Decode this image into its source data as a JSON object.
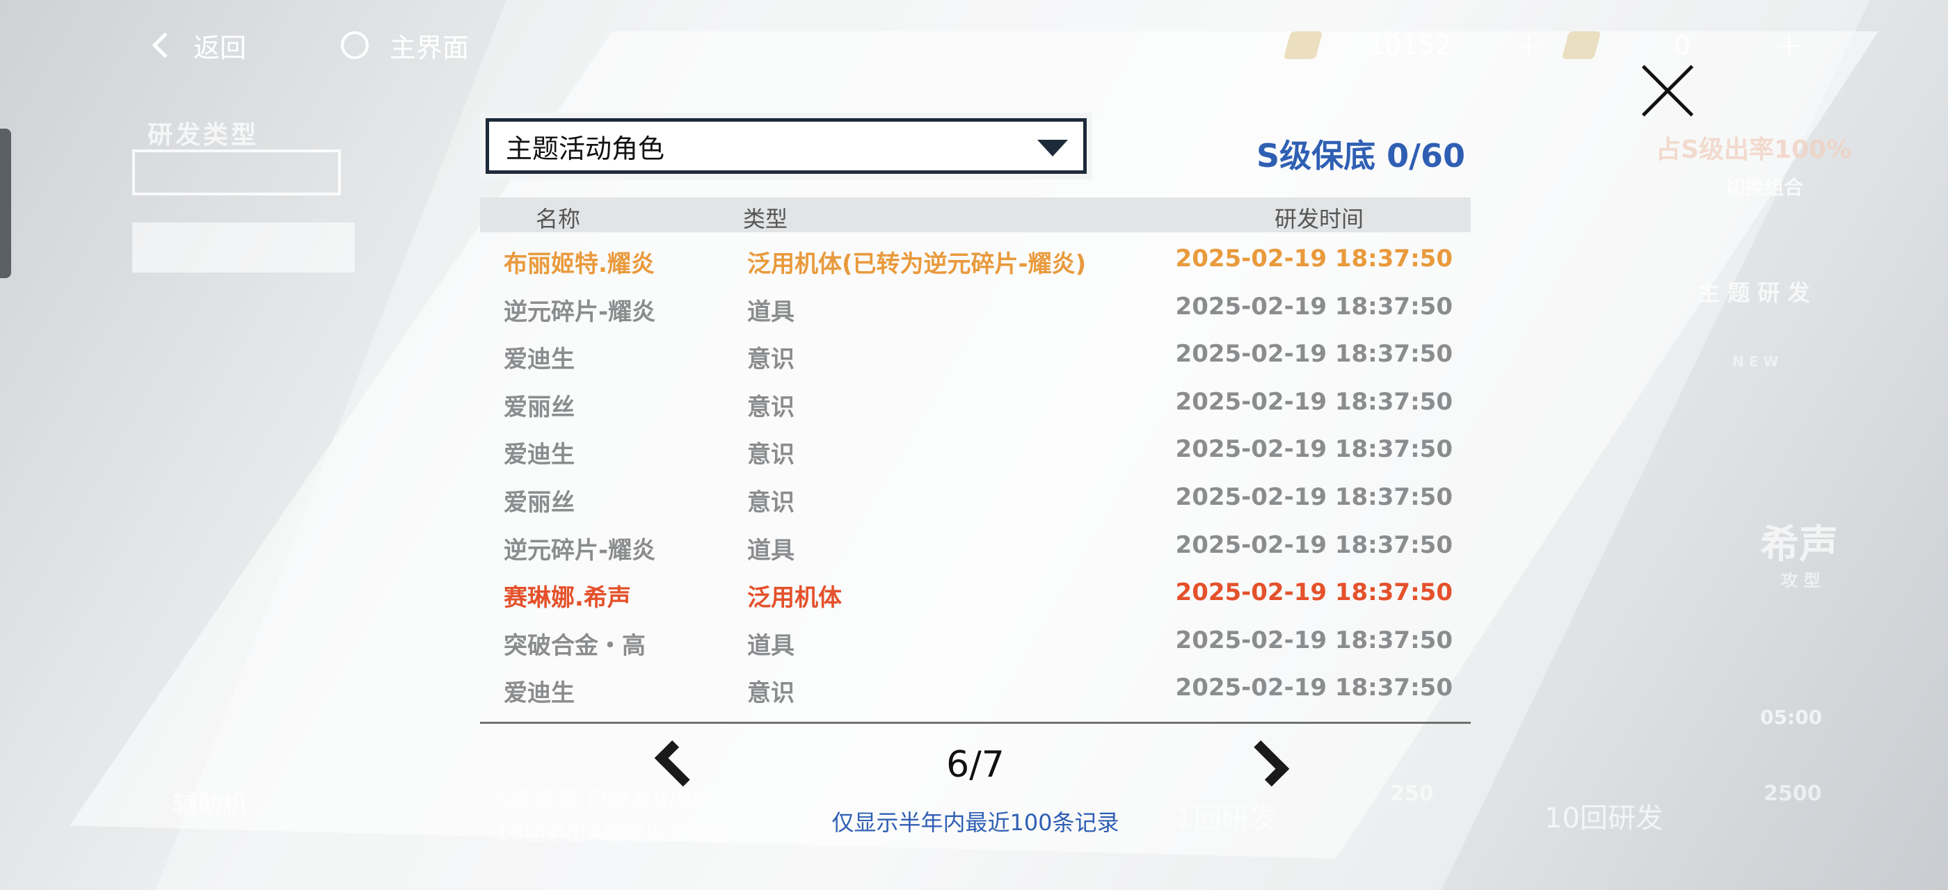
{
  "topbar": {
    "back_label": "返回",
    "home_label": "主界面",
    "currency1_value": "10152",
    "currency2_value": "0",
    "plus": "+"
  },
  "background": {
    "research_type": "研发类型",
    "s_rate": "占S级出率100%",
    "switch_combo": "切换组合",
    "theme_research": "主 题 研 发",
    "new_tag": "N E W",
    "aux_label": "辅助机",
    "pity_line1": "S级推荐 已研发0/60",
    "pity_line2": "10回必出A级或以上角色",
    "one_pull": "1回研发",
    "one_pull_cost": "250",
    "ten_pull": "10回研发",
    "ten_pull_cost": "2500",
    "timer": "05:00",
    "xisheng": "希声",
    "attack_type": "攻 型"
  },
  "modal": {
    "dropdown_value": "主题活动角色",
    "pity_label": "S级保底 0/60",
    "columns": {
      "name": "名称",
      "type": "类型",
      "time": "研发时间"
    },
    "rows": [
      {
        "name": "布丽姬特.耀炎",
        "type": "泛用机体(已转为逆元碎片-耀炎)",
        "time": "2025-02-19 18:37:50",
        "tier": "orange"
      },
      {
        "name": "逆元碎片-耀炎",
        "type": "道具",
        "time": "2025-02-19 18:37:50",
        "tier": "normal"
      },
      {
        "name": "爱迪生",
        "type": "意识",
        "time": "2025-02-19 18:37:50",
        "tier": "normal"
      },
      {
        "name": "爱丽丝",
        "type": "意识",
        "time": "2025-02-19 18:37:50",
        "tier": "normal"
      },
      {
        "name": "爱迪生",
        "type": "意识",
        "time": "2025-02-19 18:37:50",
        "tier": "normal"
      },
      {
        "name": "爱丽丝",
        "type": "意识",
        "time": "2025-02-19 18:37:50",
        "tier": "normal"
      },
      {
        "name": "逆元碎片-耀炎",
        "type": "道具",
        "time": "2025-02-19 18:37:50",
        "tier": "normal"
      },
      {
        "name": "赛琳娜.希声",
        "type": "泛用机体",
        "time": "2025-02-19 18:37:50",
        "tier": "red"
      },
      {
        "name": "突破合金・高",
        "type": "道具",
        "time": "2025-02-19 18:37:50",
        "tier": "normal"
      },
      {
        "name": "爱迪生",
        "type": "意识",
        "time": "2025-02-19 18:37:50",
        "tier": "normal"
      }
    ],
    "page": "6/7",
    "note": "仅显示半年内最近100条记录"
  },
  "colors": {
    "orange": "#e99a3c",
    "red": "#e4512b",
    "blue": "#2f5fb3",
    "gray": "#8a8c8e"
  }
}
